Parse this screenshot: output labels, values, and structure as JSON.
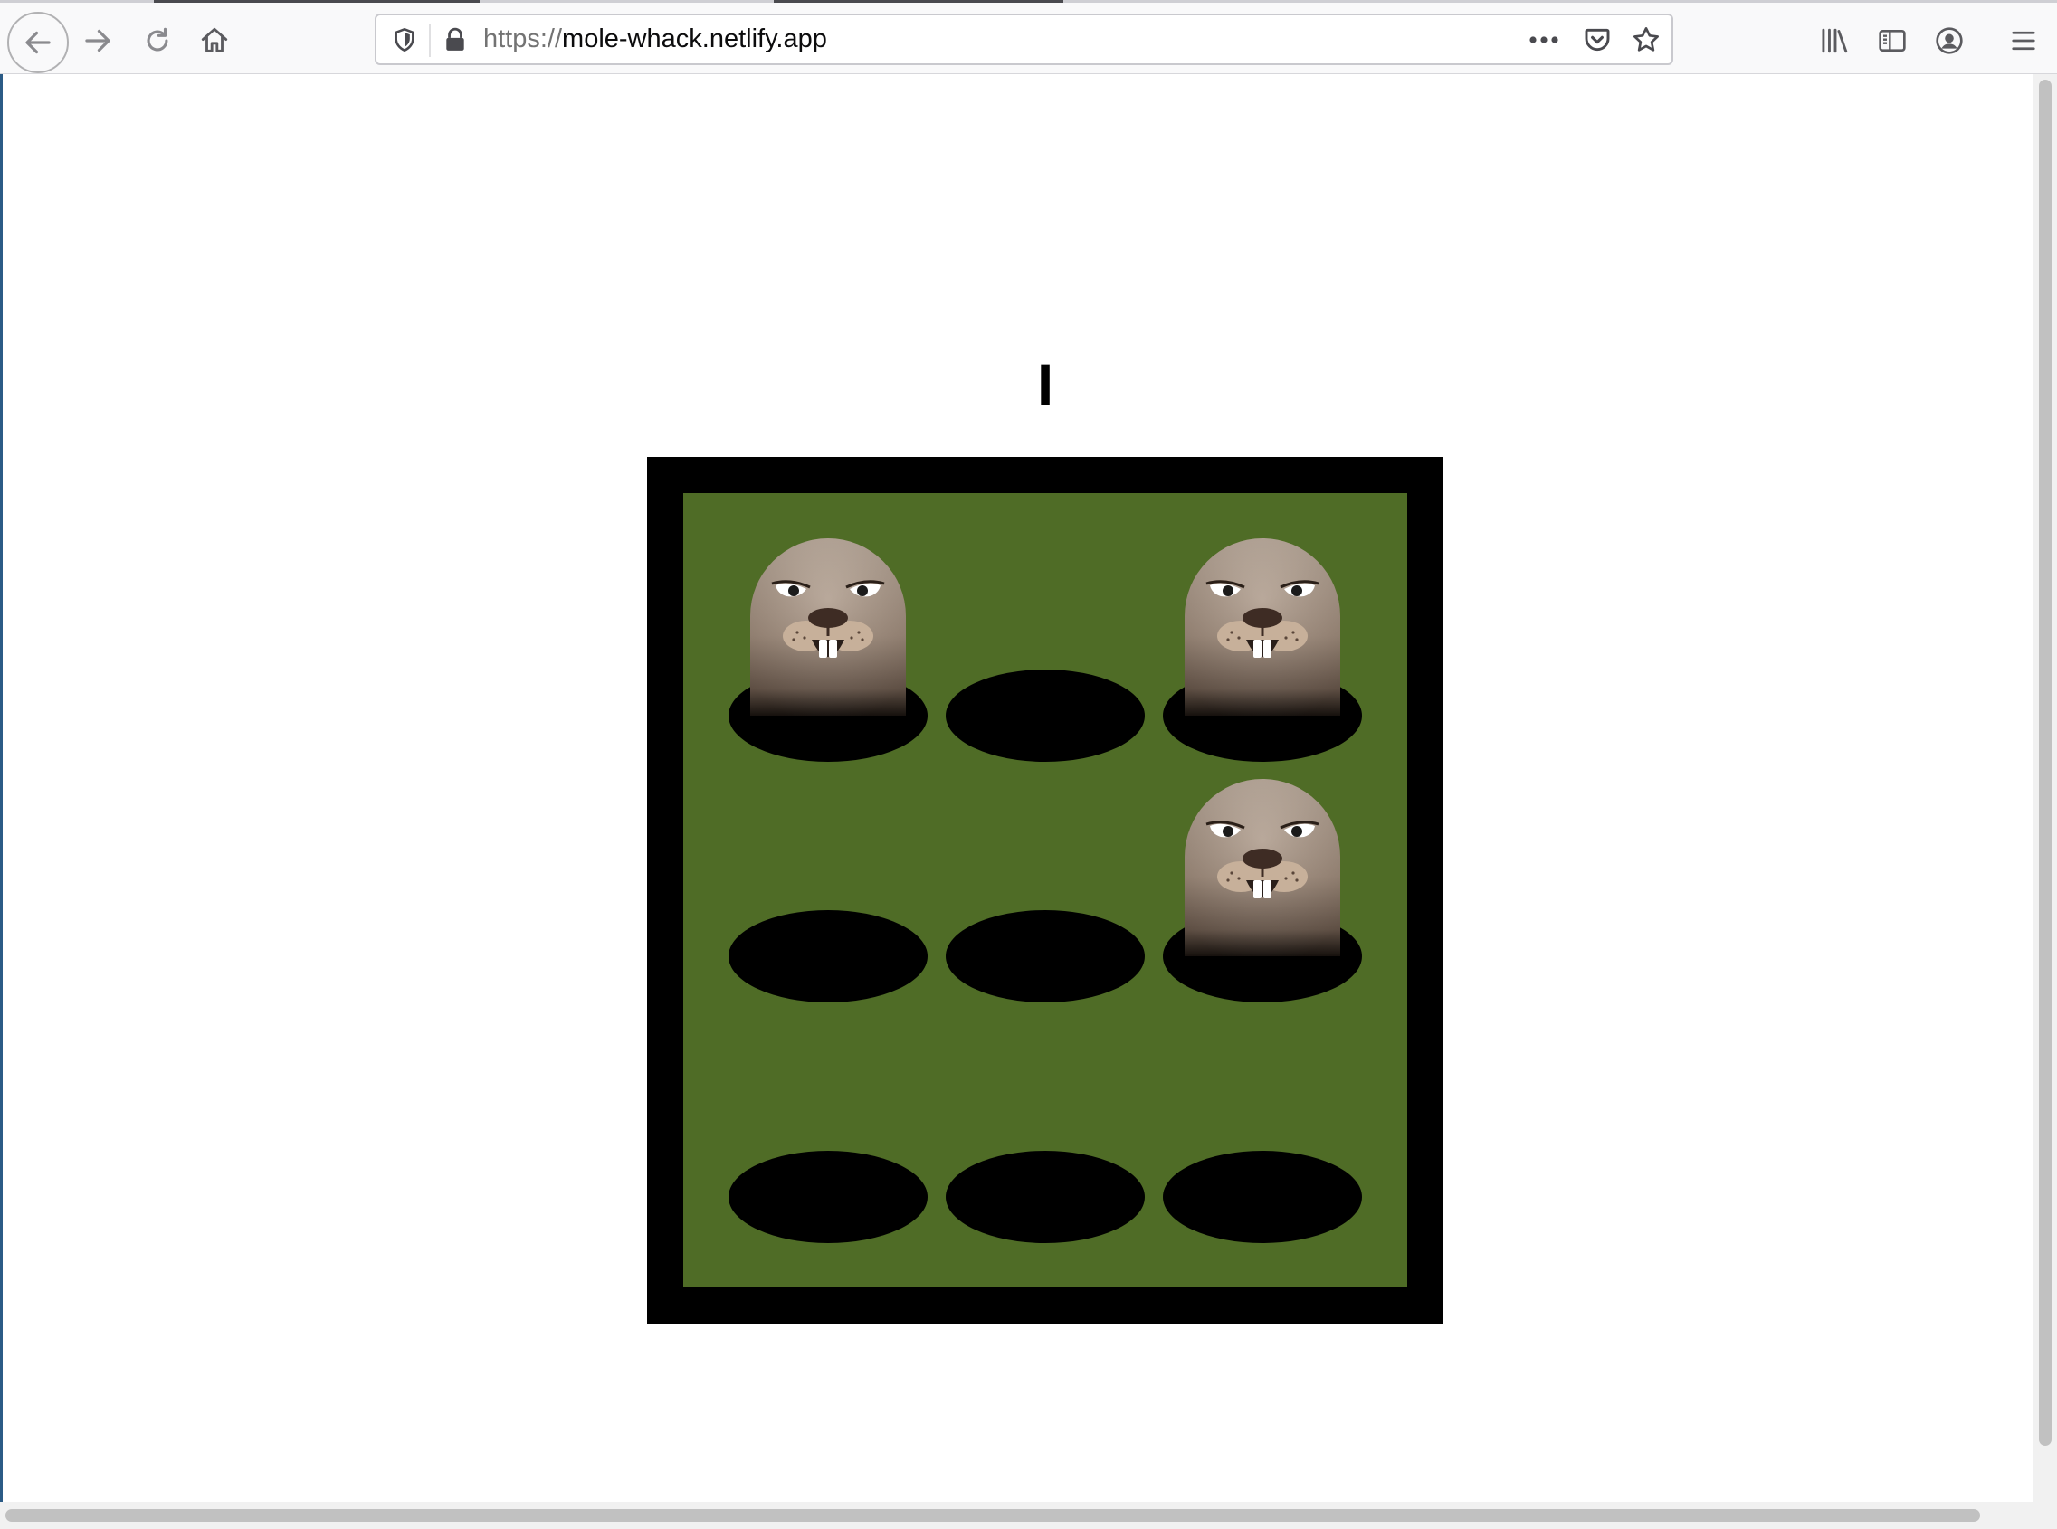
{
  "browser": {
    "url_scheme": "https://",
    "url_host": "mole-whack.netlify.app"
  },
  "game": {
    "score": "I",
    "holes": [
      {
        "row": 1,
        "col": 1,
        "mole_up": true
      },
      {
        "row": 1,
        "col": 2,
        "mole_up": false
      },
      {
        "row": 1,
        "col": 3,
        "mole_up": true
      },
      {
        "row": 2,
        "col": 1,
        "mole_up": false
      },
      {
        "row": 2,
        "col": 2,
        "mole_up": false
      },
      {
        "row": 2,
        "col": 3,
        "mole_up": true
      },
      {
        "row": 3,
        "col": 1,
        "mole_up": false
      },
      {
        "row": 3,
        "col": 2,
        "mole_up": false
      },
      {
        "row": 3,
        "col": 3,
        "mole_up": false
      }
    ]
  },
  "colors": {
    "board_border": "#000000",
    "grass": "#4f6c26",
    "hole": "#000000",
    "mole_fur": "#a08b7a"
  },
  "icons": [
    "back-arrow-icon",
    "forward-arrow-icon",
    "reload-icon",
    "home-icon",
    "shield-icon",
    "lock-icon",
    "more-dots-icon",
    "pocket-icon",
    "star-icon",
    "library-icon",
    "sidebar-icon",
    "account-icon",
    "menu-icon"
  ]
}
